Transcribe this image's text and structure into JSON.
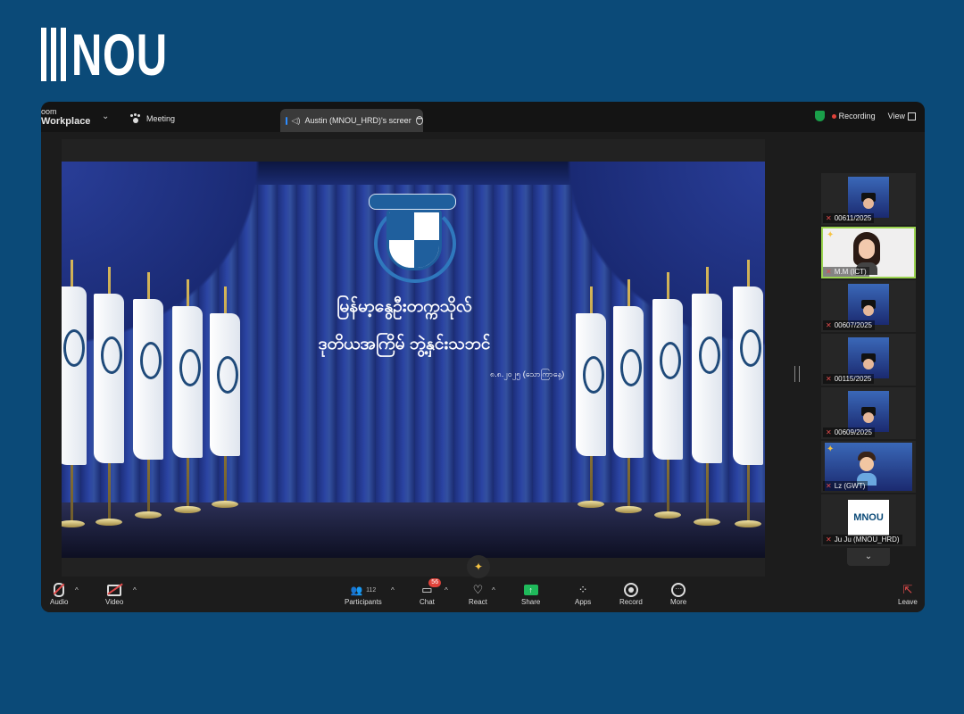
{
  "brand": {
    "text": "NOU"
  },
  "titlebar": {
    "product_line1": "oom",
    "product_line2": "Workplace",
    "meeting_label": "Meeting",
    "share_tab_label": "Austin (MNOU_HRD)'s screer",
    "recording_label": "Recording",
    "view_label": "View"
  },
  "stage": {
    "title_line1": "မြန်မာ့နွေဦးတက္ကသိုလ်",
    "title_line2": "ဒုတိယအကြိမ် ဘွဲ့နှင်းသဘင်",
    "date_text": "၈.၈.၂၀၂၅ (သောကြာနေ့)"
  },
  "gallery": {
    "tiles": [
      {
        "name": "00611/2025"
      },
      {
        "name": "M.M (ICT)"
      },
      {
        "name": "00607/2025"
      },
      {
        "name": "00115/2025"
      },
      {
        "name": "00609/2025"
      },
      {
        "name": "Lz (GWT)"
      },
      {
        "name": "Ju Ju (MNOU_HRD)"
      }
    ],
    "logo_text": "MNOU"
  },
  "toolbar": {
    "audio": "Audio",
    "video": "Video",
    "participants": "Participants",
    "participants_count": "112",
    "chat": "Chat",
    "chat_badge": "56",
    "react": "React",
    "share": "Share",
    "apps": "Apps",
    "record": "Record",
    "more": "More",
    "leave": "Leave"
  },
  "colors": {
    "page_background": "#0b4a78",
    "window_background": "#1c1c1c",
    "recording_dot": "#e0423a",
    "share_green": "#1fba5b",
    "muted_red": "#e04a4a",
    "curtain_blue": "#2b44a3"
  }
}
